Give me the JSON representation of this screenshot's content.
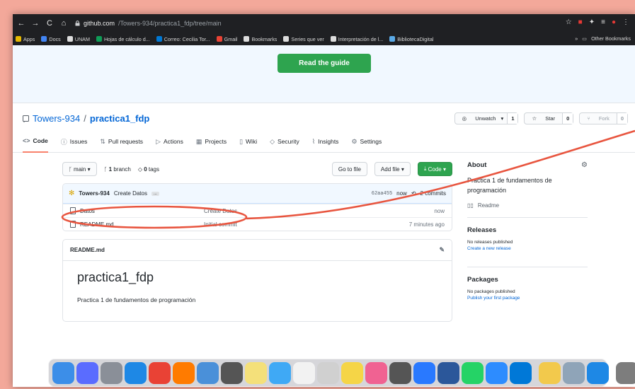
{
  "browser": {
    "nav": {
      "back": "←",
      "forward": "→",
      "reload": "C",
      "home": "⌂"
    },
    "url_host": "github.com",
    "url_path": "/Towers-934/practica1_fdp/tree/main"
  },
  "bookmarks": [
    {
      "label": "Apps",
      "color": "#e6b800"
    },
    {
      "label": "Docs",
      "color": "#4285f4"
    },
    {
      "label": "UNAM",
      "color": "#dddddd"
    },
    {
      "label": "Hojas de cálculo d...",
      "color": "#0f9d58"
    },
    {
      "label": "Correo: Cecilia Tor...",
      "color": "#0078d4"
    },
    {
      "label": "Gmail",
      "color": "#ea4335"
    },
    {
      "label": "Bookmarks",
      "color": "#dddddd"
    },
    {
      "label": "Series que ver",
      "color": "#dddddd"
    },
    {
      "label": "Interpretación de l...",
      "color": "#dddddd"
    },
    {
      "label": "BibliotecaDigital",
      "color": "#5aa9e6"
    }
  ],
  "bookmarks_more": "»",
  "bookmarks_other": "Other Bookmarks",
  "hero": {
    "button": "Read the guide"
  },
  "repo": {
    "owner": "Towers-934",
    "separator": "/",
    "name": "practica1_fdp",
    "watch": "Unwatch",
    "watch_count": "1",
    "star": "Star",
    "star_count": "0",
    "fork": "Fork",
    "fork_count": "0"
  },
  "tabs": [
    {
      "icon": "<>",
      "label": "Code"
    },
    {
      "icon": "ⓘ",
      "label": "Issues"
    },
    {
      "icon": "⇅",
      "label": "Pull requests"
    },
    {
      "icon": "▷",
      "label": "Actions"
    },
    {
      "icon": "▦",
      "label": "Projects"
    },
    {
      "icon": "▯",
      "label": "Wiki"
    },
    {
      "icon": "◇",
      "label": "Security"
    },
    {
      "icon": "⌇",
      "label": "Insights"
    },
    {
      "icon": "⚙",
      "label": "Settings"
    }
  ],
  "toolbar": {
    "branch": "main",
    "branches_count": "1",
    "branches_label": "branch",
    "tags_count": "0",
    "tags_label": "tags",
    "go_to_file": "Go to file",
    "add_file": "Add file",
    "code": "Code"
  },
  "commit": {
    "author": "Towers-934",
    "message": "Create Datos",
    "more": "...",
    "sha": "62aa455",
    "time": "now",
    "commits": "2 commits"
  },
  "files": [
    {
      "name": "Datos",
      "message": "Create Datos",
      "age": "now"
    },
    {
      "name": "README.md",
      "message": "Initial commit",
      "age": "7 minutes ago"
    }
  ],
  "readme": {
    "filename": "README.md",
    "heading": "practica1_fdp",
    "text": "Practica 1 de fundamentos de programación"
  },
  "about": {
    "title": "About",
    "description": "Practica 1 de fundamentos de programación",
    "readme_link": "Readme"
  },
  "releases": {
    "title": "Releases",
    "none": "No releases published",
    "link": "Create a new release"
  },
  "packages": {
    "title": "Packages",
    "none": "No packages published",
    "link": "Publish your first package"
  },
  "dock": {
    "colors": [
      "#3c8ee8",
      "#5a6cff",
      "#8a8f98",
      "#1e88e5",
      "#e94235",
      "#ff7b00",
      "#4a90d9",
      "#555555",
      "#f4e07a",
      "#3fa9f5",
      "#f2f2f2",
      "#d0d0d0",
      "#f5d547",
      "#f06292",
      "#555555",
      "#2979ff",
      "#2b579a",
      "#25d366",
      "#2d8cff",
      "#0078d7",
      "#f2c94c",
      "#8fa4b8",
      "#1e88e5",
      "#7d7d7d"
    ]
  },
  "annotation_color": "#e8553f"
}
